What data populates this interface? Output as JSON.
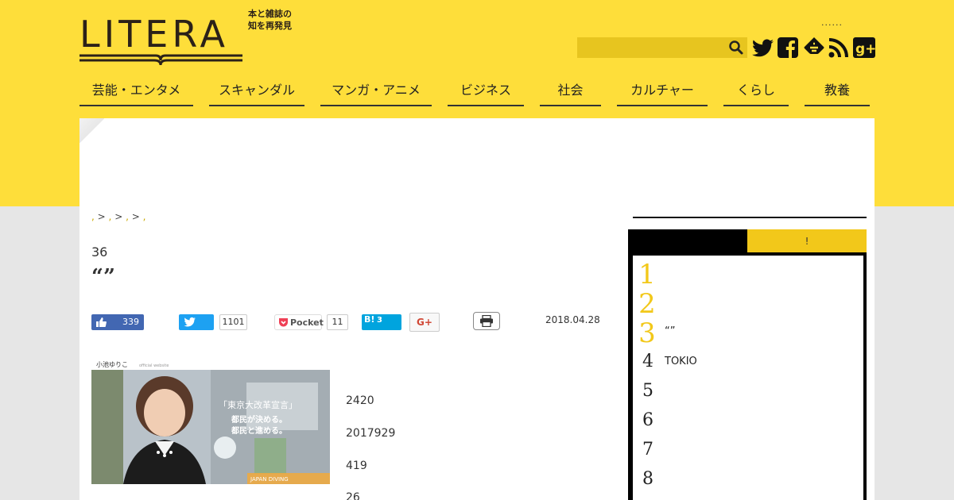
{
  "brand": {
    "logo_text": "LITERA",
    "tagline_line1": "本と雑誌の",
    "tagline_line2": "知を再発見"
  },
  "header": {
    "dots": "......",
    "search_placeholder": ""
  },
  "nav": {
    "items": [
      {
        "label": "芸能・エンタメ"
      },
      {
        "label": "スキャンダル"
      },
      {
        "label": "マンガ・アニメ"
      },
      {
        "label": "ビジネス"
      },
      {
        "label": "社会"
      },
      {
        "label": "カルチャー"
      },
      {
        "label": "くらし"
      },
      {
        "label": "教養"
      }
    ]
  },
  "breadcrumb": {
    "sep": ">"
  },
  "article": {
    "number_line": "36",
    "title": "“”",
    "date": "2018.04.28",
    "share": {
      "facebook_count": "339",
      "twitter_count": "1101",
      "pocket_label": "Pocket",
      "pocket_count": "11",
      "hatena_label": "B!",
      "hatena_count": "3",
      "gplus_label": "G+"
    },
    "body_lines": [
      "2420",
      "2017929",
      "419",
      "26"
    ],
    "photo": {
      "header_name": "小池ゆりこ",
      "header_sub": "official website",
      "caption_title": "「東京大改革宣言」",
      "caption_line1": "都民が決める。",
      "caption_line2": "都民と進める。",
      "badge": "JAPAN DIVING"
    }
  },
  "sidebar": {
    "tab_right_label": "!",
    "ranking": [
      {
        "rank": "1",
        "text": ""
      },
      {
        "rank": "2",
        "text": ""
      },
      {
        "rank": "3",
        "text": "“”"
      },
      {
        "rank": "4",
        "text": "TOKIO"
      },
      {
        "rank": "5",
        "text": ""
      },
      {
        "rank": "6",
        "text": ""
      },
      {
        "rank": "7",
        "text": ""
      },
      {
        "rank": "8",
        "text": ""
      }
    ]
  },
  "colors": {
    "brand_yellow": "#fede3a",
    "rank_gold": "#f2c81a",
    "facebook": "#4267b2",
    "twitter": "#1da1f2",
    "hatena": "#00a4de"
  }
}
